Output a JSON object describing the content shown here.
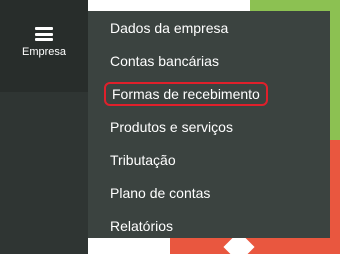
{
  "nav": {
    "empresa_label": "Empresa",
    "icon": "hamburger-menu-icon"
  },
  "dropdown": {
    "items": [
      {
        "label": "Dados da empresa"
      },
      {
        "label": "Contas bancárias"
      },
      {
        "label": "Formas de recebimento",
        "highlighted": true
      },
      {
        "label": "Produtos e serviços"
      },
      {
        "label": "Tributação"
      },
      {
        "label": "Plano de contas"
      },
      {
        "label": "Relatórios"
      }
    ]
  },
  "colors": {
    "rail": "#2f3533",
    "menu_bg": "#3b4340",
    "highlight_border": "#e0202b",
    "accent_green": "#8cc152",
    "accent_red": "#e9573f"
  }
}
